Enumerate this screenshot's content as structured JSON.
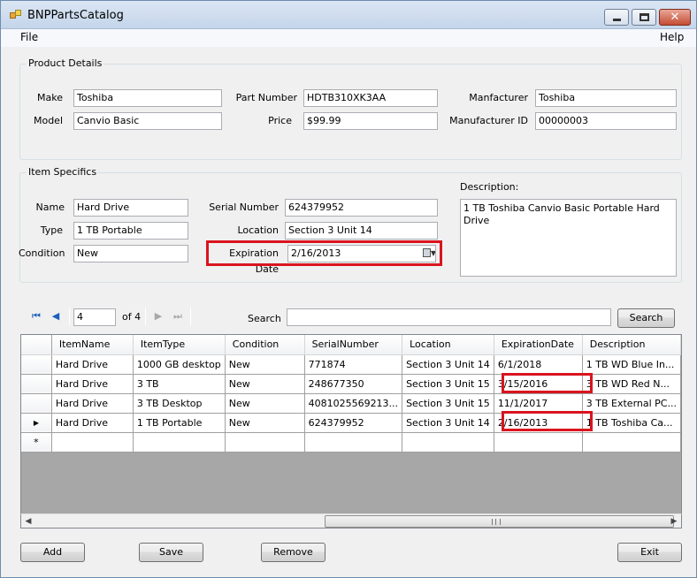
{
  "window": {
    "title": "BNPPartsCatalog"
  },
  "menu": {
    "file": "File",
    "help": "Help"
  },
  "product": {
    "group_title": "Product Details",
    "make_label": "Make",
    "make": "Toshiba",
    "model_label": "Model",
    "model": "Canvio Basic",
    "part_number_label": "Part Number",
    "part_number": "HDTB310XK3AA",
    "price_label": "Price",
    "price": "$99.99",
    "manufacturer_label": "Manfacturer",
    "manufacturer": "Toshiba",
    "manufacturer_id_label": "Manufacturer ID",
    "manufacturer_id": "00000003"
  },
  "item": {
    "group_title": "Item Specifics",
    "name_label": "Name",
    "name": "Hard Drive",
    "type_label": "Type",
    "type": "1 TB Portable",
    "condition_label": "Condition",
    "condition": "New",
    "serial_label": "Serial Number",
    "serial": "624379952",
    "location_label": "Location",
    "location": "Section 3 Unit 14",
    "expiration_label": "Expiration Date",
    "expiration": "2/16/2013"
  },
  "description": {
    "label": "Description:",
    "text": "1 TB Toshiba Canvio Basic Portable Hard Drive"
  },
  "navigator": {
    "position": "4",
    "count": "of 4"
  },
  "search": {
    "label": "Search",
    "value": "",
    "button": "Search"
  },
  "grid": {
    "columns": [
      "ItemName",
      "ItemType",
      "Condition",
      "SerialNumber",
      "Location",
      "ExpirationDate",
      "Description"
    ],
    "rows": [
      [
        "Hard Drive",
        "1000 GB desktop",
        "New",
        "771874",
        "Section 3 Unit 14",
        "6/1/2018",
        "1 TB WD Blue In..."
      ],
      [
        "Hard Drive",
        "3 TB",
        "New",
        "248677350",
        "Section 3 Unit 15",
        "3/15/2016",
        "3 TB WD Red N..."
      ],
      [
        "Hard Drive",
        "3 TB Desktop",
        "New",
        "4081025569213...",
        "Section 3 Unit 15",
        "11/1/2017",
        "3 TB External PC..."
      ],
      [
        "Hard Drive",
        "1 TB Portable",
        "New",
        "624379952",
        "Section 3 Unit 14",
        "2/16/2013",
        "1 TB Toshiba Ca..."
      ]
    ],
    "current_row_marker": "▶",
    "new_row_marker": "*"
  },
  "buttons": {
    "add": "Add",
    "save": "Save",
    "remove": "Remove",
    "exit": "Exit"
  },
  "colors": {
    "highlight": "#d9141f",
    "grid_background": "#a7a7a7"
  }
}
